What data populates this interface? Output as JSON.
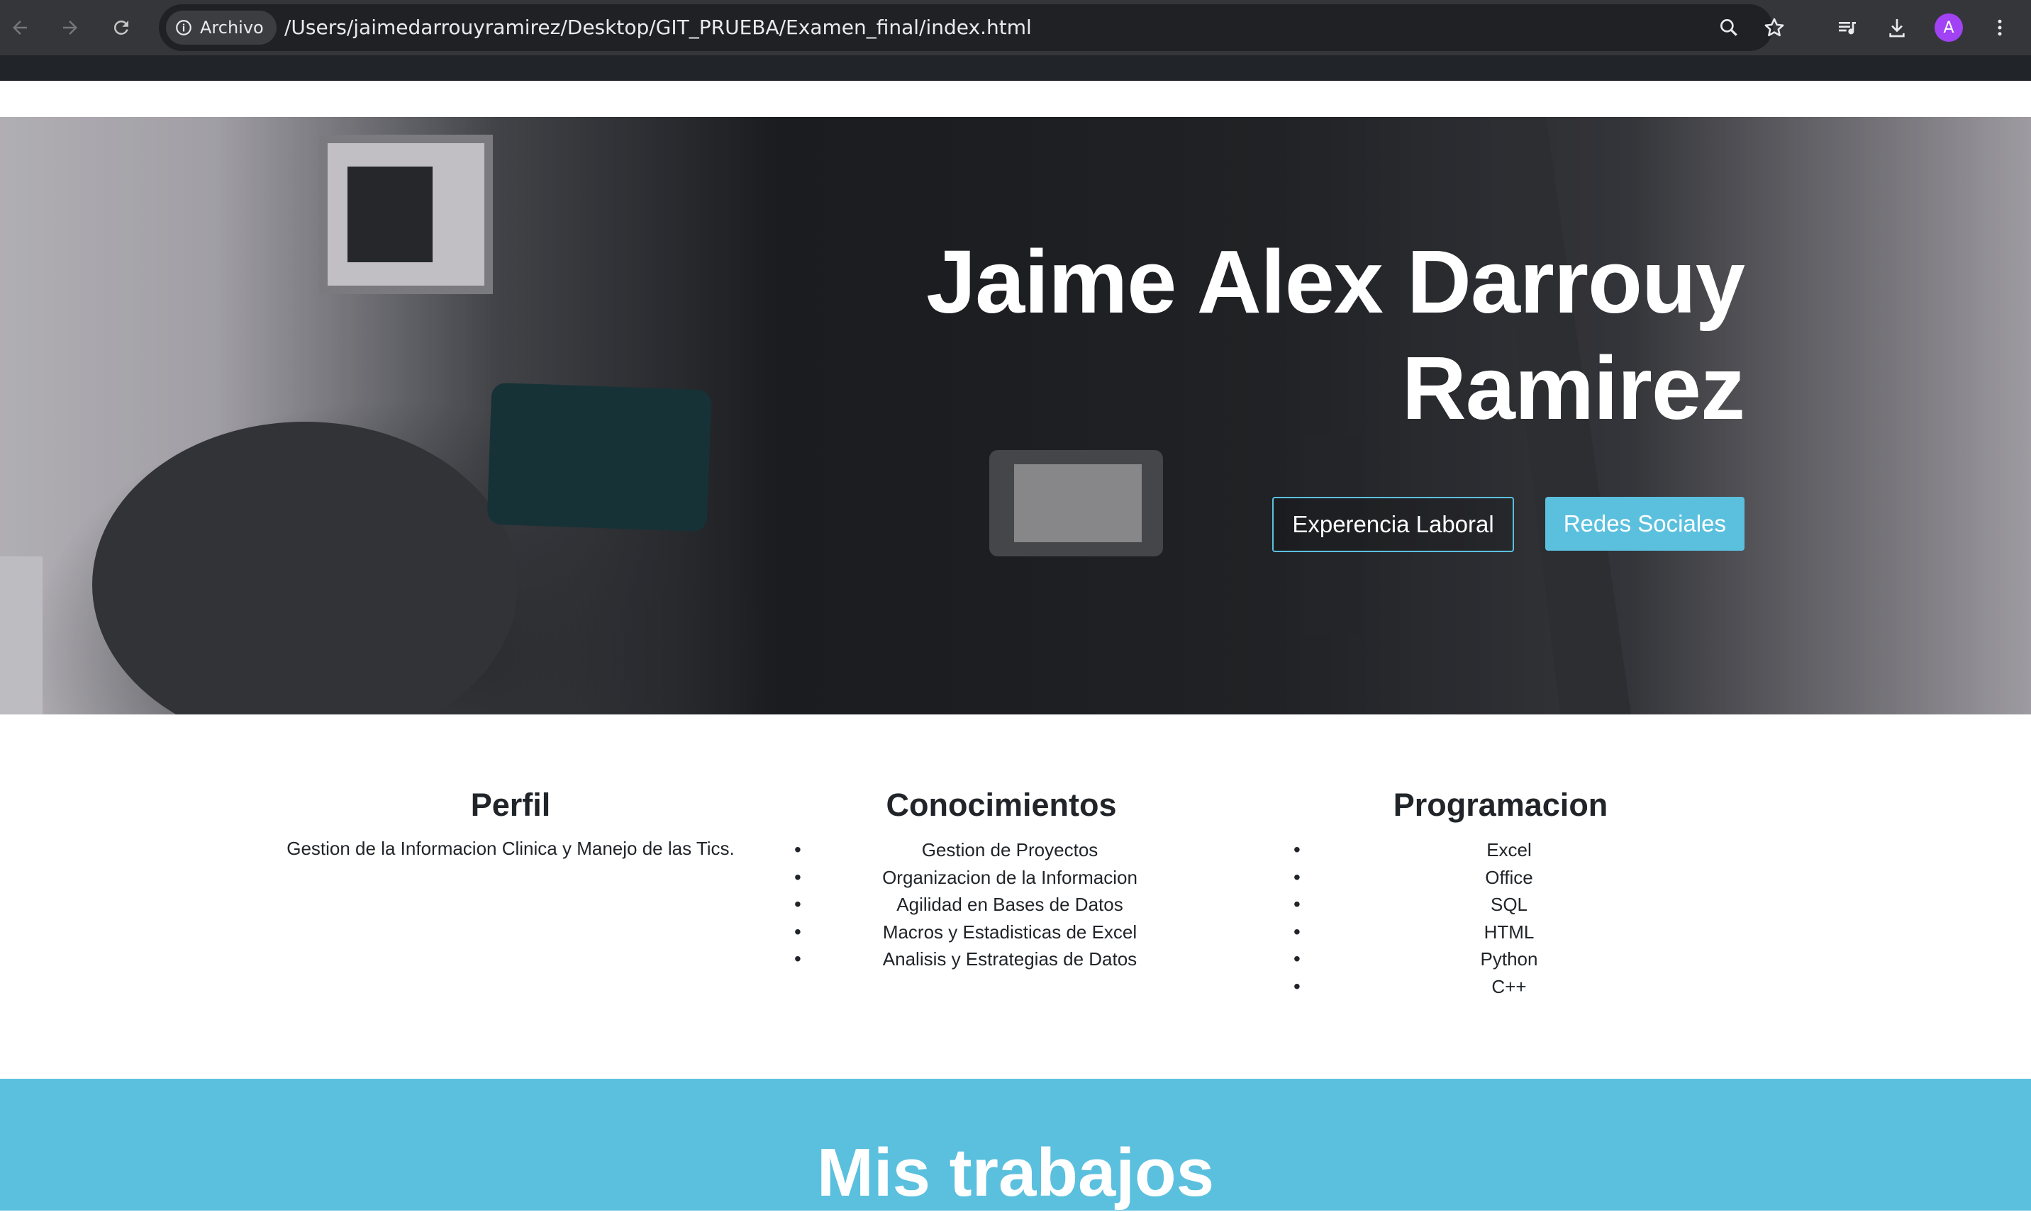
{
  "browser": {
    "back_icon": "arrow-left-icon",
    "forward_icon": "arrow-right-icon",
    "reload_icon": "reload-icon",
    "site_info_label": "Archivo",
    "url": "/Users/jaimedarrouyramirez/Desktop/GIT_PRUEBA/Examen_final/index.html",
    "avatar_letter": "A",
    "avatar_color": "#a142f4"
  },
  "hero": {
    "title_line1": "Jaime Alex Darrouy",
    "title_line2": "Ramirez",
    "btn_experience": "Experencia Laboral",
    "btn_social": "Redes Sociales",
    "accent_color": "#5bc0de"
  },
  "sections": {
    "perfil": {
      "heading": "Perfil",
      "text": "Gestion de la Informacion Clinica y Manejo de las Tics."
    },
    "conocimientos": {
      "heading": "Conocimientos",
      "items": [
        "Gestion de Proyectos",
        "Organizacion de la Informacion",
        "Agilidad en Bases de Datos",
        "Macros y Estadisticas de Excel",
        "Analisis y Estrategias de Datos"
      ]
    },
    "programacion": {
      "heading": "Programacion",
      "items": [
        "Excel",
        "Office",
        "SQL",
        "HTML",
        "Python",
        "C++"
      ]
    }
  },
  "works": {
    "heading": "Mis trabajos"
  }
}
